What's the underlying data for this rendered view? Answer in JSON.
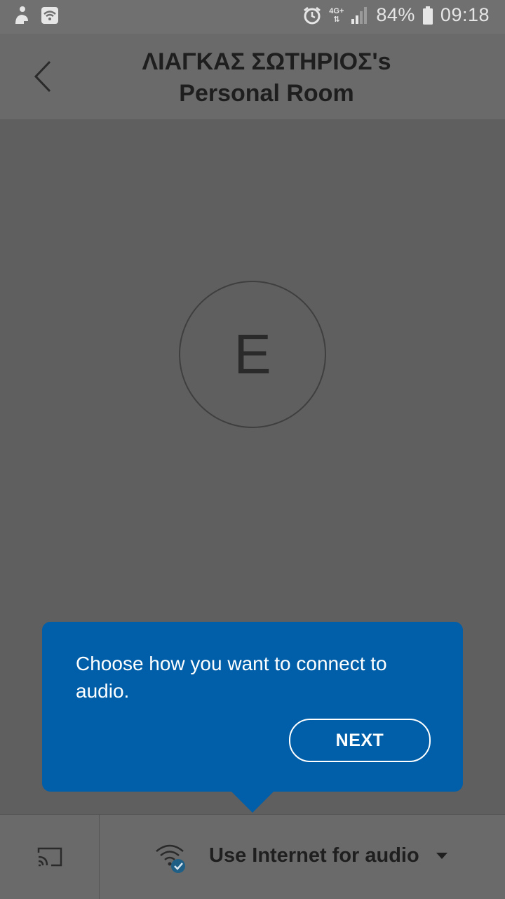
{
  "status_bar": {
    "left_icons": [
      "notification-person-icon",
      "wifi-icon"
    ],
    "network_type": "4G+",
    "battery_percent": "84%",
    "time": "09:18",
    "icons": [
      "alarm-icon",
      "signal-icon",
      "battery-icon"
    ]
  },
  "header": {
    "title_line1": "ΛΙΑΓΚΑΣ ΣΩΤΗΡΙΟΣ's",
    "title_line2": "Personal Room",
    "back_icon": "chevron-left-icon"
  },
  "avatar": {
    "initial": "E"
  },
  "tooltip": {
    "text": "Choose how you want to connect to audio.",
    "next_label": "NEXT",
    "background_color": "#005fa8"
  },
  "bottom_bar": {
    "cast_icon": "cast-icon",
    "audio_icon": "wifi-check-icon",
    "audio_label": "Use Internet for audio",
    "dropdown_icon": "caret-down-icon"
  }
}
